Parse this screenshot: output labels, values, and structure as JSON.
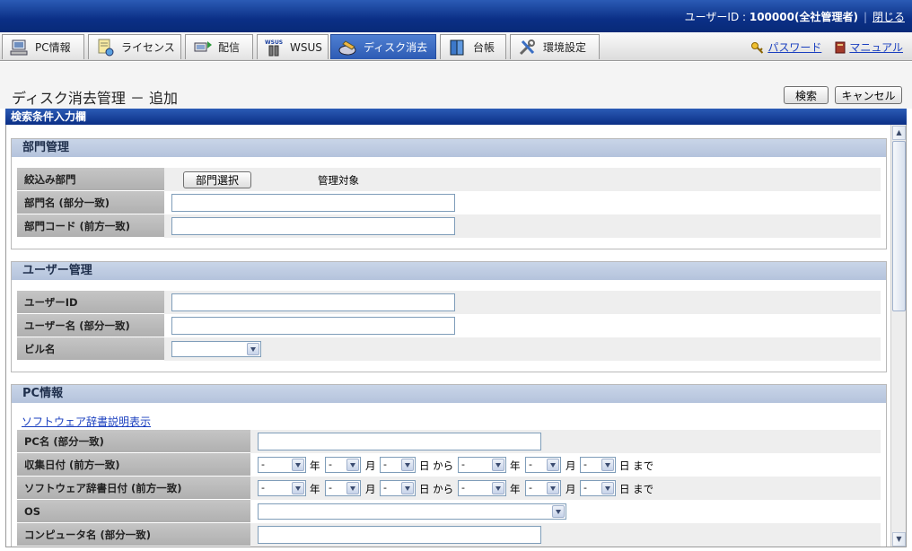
{
  "header": {
    "user_label": "ユーザーID : ",
    "user_value": "100000(全社管理者)",
    "close_label": "閉じる"
  },
  "tabs": [
    {
      "label": "PC情報",
      "icon": "pc-icon"
    },
    {
      "label": "ライセンス",
      "icon": "license-icon"
    },
    {
      "label": "配信",
      "icon": "distribution-icon"
    },
    {
      "label": "WSUS",
      "icon": "wsus-icon",
      "badge": "WSUS"
    },
    {
      "label": "ディスク消去",
      "icon": "disk-erase-icon"
    },
    {
      "label": "台帳",
      "icon": "ledger-icon"
    },
    {
      "label": "環境設定",
      "icon": "settings-icon"
    }
  ],
  "links": {
    "password": "パスワード",
    "manual": "マニュアル"
  },
  "page": {
    "title": "ディスク消去管理 － 追加",
    "search_button": "検索",
    "cancel_button": "キャンセル",
    "panel_title": "検索条件入力欄"
  },
  "dept": {
    "title": "部門管理",
    "filter_label": "絞込み部門",
    "select_button": "部門選択",
    "target_text": "管理対象",
    "name_label": "部門名 (部分一致)",
    "code_label": "部門コード (前方一致)"
  },
  "user": {
    "title": "ユーザー管理",
    "id_label": "ユーザーID",
    "name_label": "ユーザー名 (部分一致)",
    "building_label": "ビル名"
  },
  "pc": {
    "title": "PC情報",
    "dict_link": "ソフトウェア辞書説明表示",
    "pcname_label": "PC名 (部分一致)",
    "collect_label": "収集日付 (前方一致)",
    "dictdate_label": "ソフトウェア辞書日付 (前方一致)",
    "os_label": "OS",
    "computer_label": "コンピュータ名 (部分一致)",
    "dash": "-",
    "year": "年",
    "month": "月",
    "day_from": "日 から",
    "day_to": "日 まで"
  },
  "colors": {
    "header_blue": "#0b2f86",
    "section_head": "#b4c3dc",
    "label_gray": "#b0b0b0",
    "link": "#1a3fbf"
  }
}
